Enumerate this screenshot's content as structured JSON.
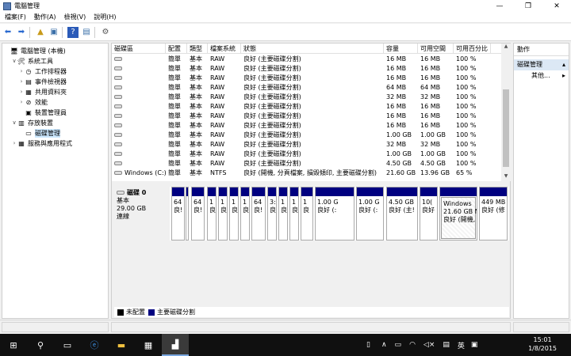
{
  "window": {
    "title": "電腦管理",
    "min": "—",
    "max": "❐",
    "close": "✕"
  },
  "menu": [
    "檔案(F)",
    "動作(A)",
    "檢視(V)",
    "說明(H)"
  ],
  "tree": [
    {
      "label": "電腦管理 (本機)",
      "level": 0,
      "twisty": "",
      "icon": "computer-icon",
      "glyph": "🖥"
    },
    {
      "label": "系統工具",
      "level": 1,
      "twisty": "∨",
      "icon": "tools-icon",
      "glyph": "🛠"
    },
    {
      "label": "工作排程器",
      "level": 2,
      "twisty": "›",
      "icon": "clock-icon",
      "glyph": "◷"
    },
    {
      "label": "事件檢視器",
      "level": 2,
      "twisty": "›",
      "icon": "event-viewer-icon",
      "glyph": "▤"
    },
    {
      "label": "共用資料夾",
      "level": 2,
      "twisty": "›",
      "icon": "shared-folder-icon",
      "glyph": "▦"
    },
    {
      "label": "效能",
      "level": 2,
      "twisty": "›",
      "icon": "performance-icon",
      "glyph": "⊘"
    },
    {
      "label": "裝置管理員",
      "level": 2,
      "twisty": "",
      "icon": "device-manager-icon",
      "glyph": "▣"
    },
    {
      "label": "存放裝置",
      "level": 1,
      "twisty": "∨",
      "icon": "storage-icon",
      "glyph": "▥"
    },
    {
      "label": "磁碟管理",
      "level": 2,
      "twisty": "",
      "icon": "disk-management-icon",
      "glyph": "▭",
      "selected": true
    },
    {
      "label": "服務與應用程式",
      "level": 1,
      "twisty": "›",
      "icon": "services-icon",
      "glyph": "▦"
    }
  ],
  "volumes": {
    "headers": [
      "磁碟區",
      "配置",
      "類型",
      "檔案系統",
      "狀態",
      "容量",
      "可用空間",
      "可用百分比"
    ],
    "rows": [
      [
        "",
        "簡單",
        "基本",
        "RAW",
        "良好 (主要磁碟分割)",
        "16 MB",
        "16 MB",
        "100 %"
      ],
      [
        "",
        "簡單",
        "基本",
        "RAW",
        "良好 (主要磁碟分割)",
        "16 MB",
        "16 MB",
        "100 %"
      ],
      [
        "",
        "簡單",
        "基本",
        "RAW",
        "良好 (主要磁碟分割)",
        "16 MB",
        "16 MB",
        "100 %"
      ],
      [
        "",
        "簡單",
        "基本",
        "RAW",
        "良好 (主要磁碟分割)",
        "64 MB",
        "64 MB",
        "100 %"
      ],
      [
        "",
        "簡單",
        "基本",
        "RAW",
        "良好 (主要磁碟分割)",
        "32 MB",
        "32 MB",
        "100 %"
      ],
      [
        "",
        "簡單",
        "基本",
        "RAW",
        "良好 (主要磁碟分割)",
        "16 MB",
        "16 MB",
        "100 %"
      ],
      [
        "",
        "簡單",
        "基本",
        "RAW",
        "良好 (主要磁碟分割)",
        "16 MB",
        "16 MB",
        "100 %"
      ],
      [
        "",
        "簡單",
        "基本",
        "RAW",
        "良好 (主要磁碟分割)",
        "16 MB",
        "16 MB",
        "100 %"
      ],
      [
        "",
        "簡單",
        "基本",
        "RAW",
        "良好 (主要磁碟分割)",
        "1.00 GB",
        "1.00 GB",
        "100 %"
      ],
      [
        "",
        "簡單",
        "基本",
        "RAW",
        "良好 (主要磁碟分割)",
        "32 MB",
        "32 MB",
        "100 %"
      ],
      [
        "",
        "簡單",
        "基本",
        "RAW",
        "良好 (主要磁碟分割)",
        "1.00 GB",
        "1.00 GB",
        "100 %"
      ],
      [
        "",
        "簡單",
        "基本",
        "RAW",
        "良好 (主要磁碟分割)",
        "4.50 GB",
        "4.50 GB",
        "100 %"
      ],
      [
        "Windows (C:)",
        "簡單",
        "基本",
        "NTFS",
        "良好 (開機, 分頁檔案, 損毀傾印, 主要磁碟分割)",
        "21.60 GB",
        "13.96 GB",
        "65 %"
      ]
    ]
  },
  "disk": {
    "name": "磁碟 0",
    "type": "基本",
    "size": "29.00 GB",
    "status": "連線"
  },
  "partitions": [
    {
      "l1": "64",
      "l2": "良!"
    },
    {
      "l1": "",
      "l2": ""
    },
    {
      "l1": "64",
      "l2": "良!"
    },
    {
      "l1": "1",
      "l2": "良"
    },
    {
      "l1": "1",
      "l2": "良"
    },
    {
      "l1": "1",
      "l2": "良"
    },
    {
      "l1": "1",
      "l2": "良"
    },
    {
      "l1": "64",
      "l2": "良!"
    },
    {
      "l1": "3:",
      "l2": "良"
    },
    {
      "l1": "1",
      "l2": "良"
    },
    {
      "l1": "1",
      "l2": "良"
    },
    {
      "l1": "1",
      "l2": "良"
    },
    {
      "l1": "1.00 G",
      "l2": "良好 (:"
    },
    {
      "l1": "1.00 G",
      "l2": "良好 (:"
    },
    {
      "l1": "4.50 GB",
      "l2": "良好 (主!"
    },
    {
      "l1": "10(",
      "l2": "良好"
    },
    {
      "l1": "21.60 GB N",
      "l2": "良好 (開機,",
      "l0": "Windows"
    },
    {
      "l1": "449 MB",
      "l2": "良好 (修"
    }
  ],
  "legend": [
    {
      "label": "未配置",
      "color": "#000000"
    },
    {
      "label": "主要磁碟分割",
      "color": "#000080"
    }
  ],
  "actions": {
    "header": "動作",
    "section": "磁碟管理",
    "more": "其他..."
  },
  "taskbar": {
    "time": "15:01",
    "date": "1/8/2015",
    "ime": "英"
  }
}
